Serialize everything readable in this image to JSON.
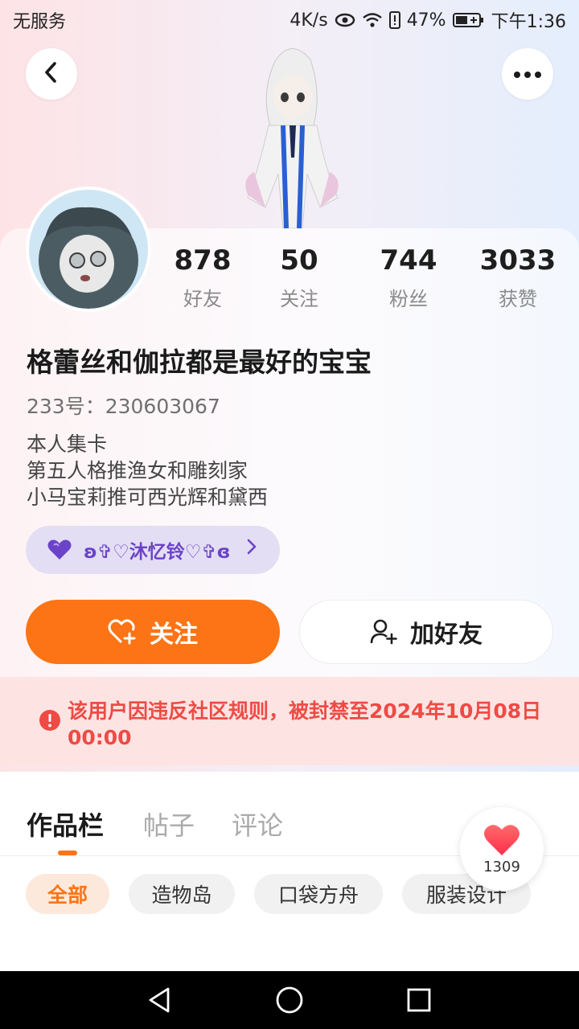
{
  "status_bar": {
    "carrier": "无服务",
    "speed": "4K/s",
    "battery": "47%",
    "time": "下午1:36"
  },
  "header": {
    "back_icon": "chevron-left-icon",
    "more_icon": "more-dots-icon"
  },
  "profile": {
    "stats": [
      {
        "value": "878",
        "label": "好友"
      },
      {
        "value": "50",
        "label": "关注"
      },
      {
        "value": "744",
        "label": "粉丝"
      },
      {
        "value": "3033",
        "label": "获赞"
      }
    ],
    "username": "格蕾丝和伽拉都是最好的宝宝",
    "uid": "233号：230603067",
    "bio": [
      "本人集卡",
      "第五人格推渔女和雕刻家",
      "小马宝莉推可西光辉和黛西"
    ],
    "guild": {
      "name": "ʚ✞♡沐忆铃♡✞ɞ",
      "icon": "heart-icon"
    }
  },
  "actions": {
    "follow_label": "关注",
    "add_friend_label": "加好友"
  },
  "ban_notice": {
    "text": "该用户因违反社区规则，被封禁至2024年10月08日 00:00"
  },
  "tabs": [
    {
      "label": "作品栏",
      "active": true
    },
    {
      "label": "帖子",
      "active": false
    },
    {
      "label": "评论",
      "active": false
    }
  ],
  "filters": [
    {
      "label": "全部",
      "active": true
    },
    {
      "label": "造物岛",
      "active": false
    },
    {
      "label": "口袋方舟",
      "active": false
    },
    {
      "label": "服装设计",
      "active": false
    }
  ],
  "like_float": {
    "count": "1309"
  },
  "colors": {
    "accent": "#fc7416",
    "ban_text": "#ee4b45",
    "ban_bg": "#fde4e3",
    "guild_text": "#6b43c9"
  }
}
